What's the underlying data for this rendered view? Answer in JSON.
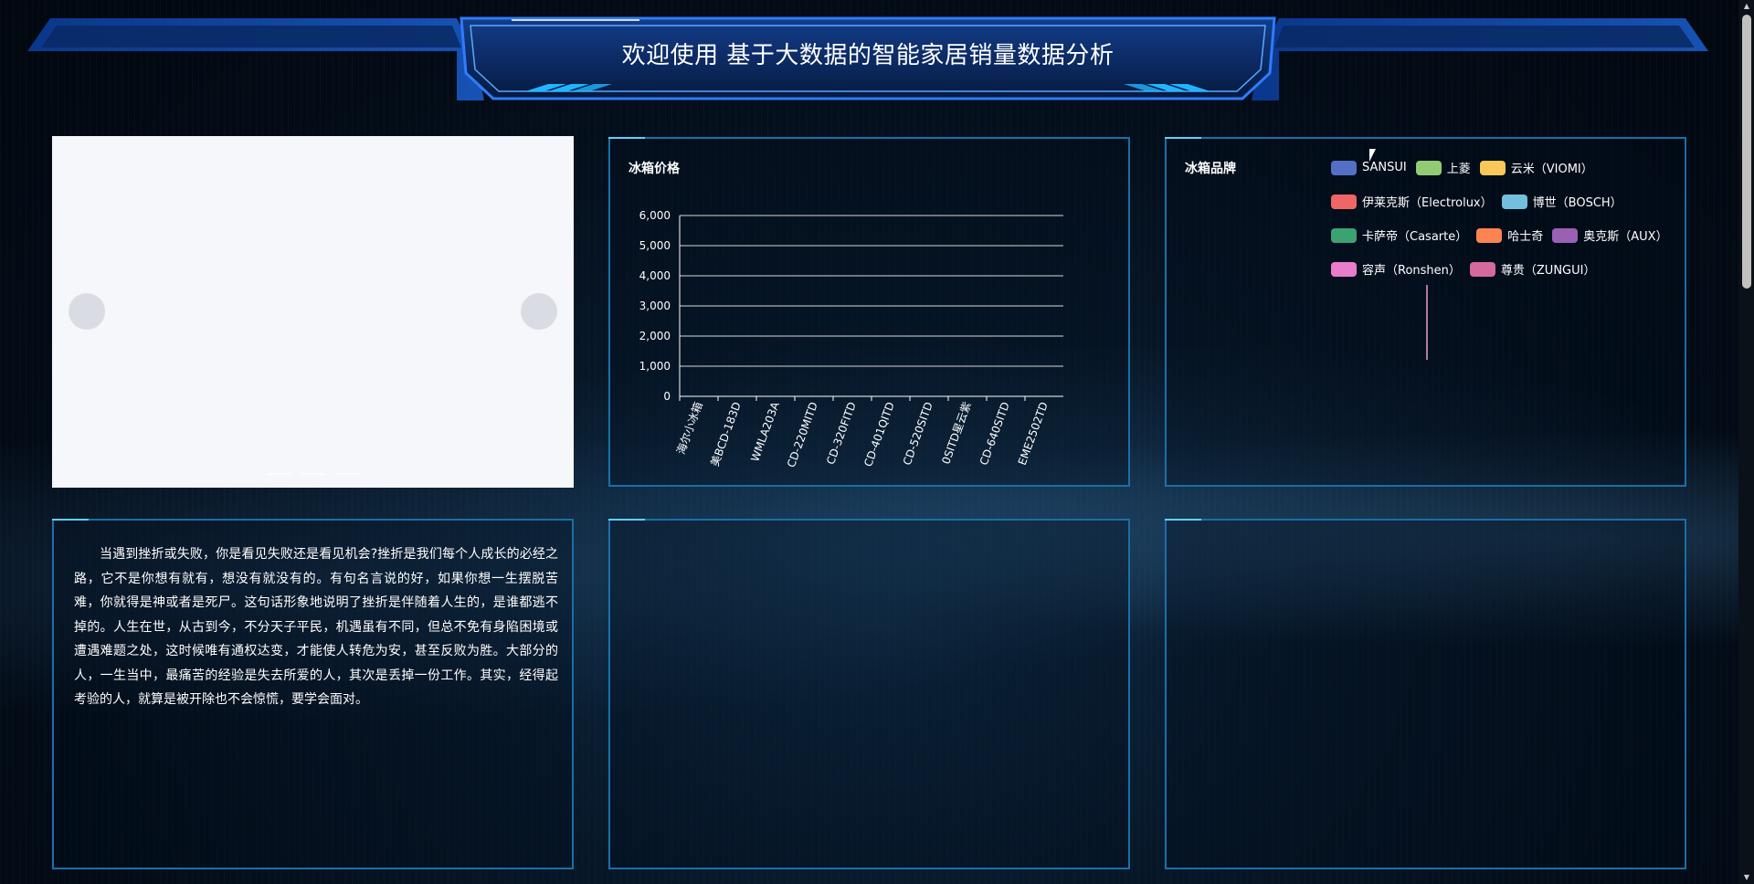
{
  "header": {
    "title": "欢迎使用 基于大数据的智能家居销量数据分析"
  },
  "carousel": {
    "prev_label": "",
    "next_label": "",
    "indicator_count": 3
  },
  "price_panel": {
    "title": "冰箱价格"
  },
  "brand_panel": {
    "title": "冰箱品牌",
    "legend": [
      {
        "label": "SANSUI",
        "color": "#5470c6"
      },
      {
        "label": "上菱",
        "color": "#91cc75"
      },
      {
        "label": "云米（VIOMI）",
        "color": "#fac858"
      },
      {
        "label": "伊莱克斯（Electrolux）",
        "color": "#ee6666"
      },
      {
        "label": "博世（BOSCH）",
        "color": "#73c0de"
      },
      {
        "label": "卡萨帝（Casarte）",
        "color": "#3ba272"
      },
      {
        "label": "哈士奇",
        "color": "#fc8452"
      },
      {
        "label": "奥克斯（AUX）",
        "color": "#9a60b4"
      },
      {
        "label": "容声（Ronshen）",
        "color": "#ea7ccc"
      },
      {
        "label": "尊贵（ZUNGUI）",
        "color": "#d46a9c"
      }
    ]
  },
  "text_panel": {
    "paragraph": "当遇到挫折或失败，你是看见失败还是看见机会?挫折是我们每个人成长的必经之路，它不是你想有就有，想没有就没有的。有句名言说的好，如果你想一生摆脱苦难，你就得是神或者是死尸。这句话形象地说明了挫折是伴随着人生的，是谁都逃不掉的。人生在世，从古到今，不分天子平民，机遇虽有不同，但总不免有身陷困境或遭遇难题之处，这时候唯有通权达变，才能使人转危为安，甚至反败为胜。大部分的人，一生当中，最痛苦的经验是失去所爱的人，其次是丢掉一份工作。其实，经得起考验的人，就算是被开除也不会惊慌，要学会面对。"
  },
  "chart_data": {
    "type": "bar",
    "title": "冰箱价格",
    "categories": [
      "海尔小冰箱",
      "美BCD-183D",
      "WMLA203A",
      "CD-220MITD",
      "CD-320FITD",
      "CD-401QITD",
      "CD-520SITD",
      "0SITD星云紫",
      "CD-640SITD",
      "EME2502TD"
    ],
    "y_ticks": [
      "0",
      "1,000",
      "2,000",
      "3,000",
      "4,000",
      "5,000",
      "6,000"
    ],
    "ylim": [
      0,
      6000
    ],
    "grid": true,
    "series": [
      {
        "values": [
          0,
          0,
          0,
          0,
          0,
          0,
          0,
          0,
          0,
          0
        ]
      }
    ]
  },
  "colors": {
    "panel_border": "#1a6fa8",
    "accent": "#5fd0ff",
    "header_fill": "#0a2d6b"
  }
}
